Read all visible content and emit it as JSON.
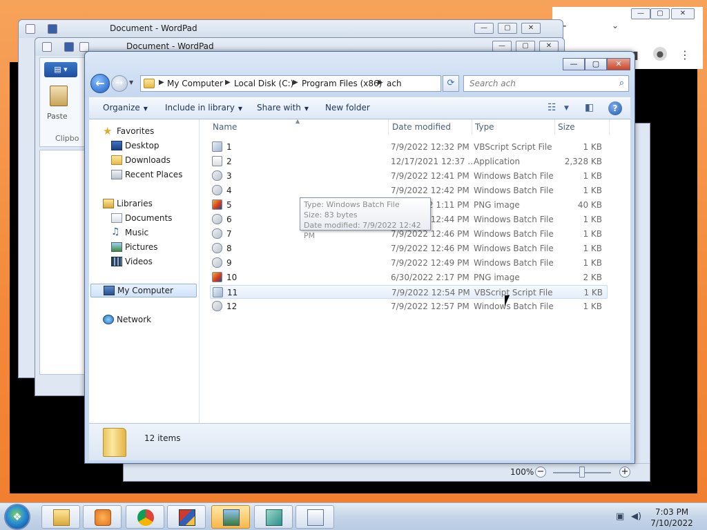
{
  "wordpad_back": {
    "title": "Document - WordPad"
  },
  "wordpad_front": {
    "title": "Document - WordPad",
    "paste_label": "Paste",
    "clipboard_label": "Clipbo",
    "zoom": "100%"
  },
  "explorer": {
    "breadcrumb": [
      "My Computer",
      "Local Disk (C:)",
      "Program Files (x86)",
      "ach"
    ],
    "search_placeholder": "Search ach",
    "toolbar": {
      "organize": "Organize",
      "include_in_library": "Include in library",
      "share_with": "Share with",
      "new_folder": "New folder"
    },
    "nav": {
      "favorites": "Favorites",
      "desktop": "Desktop",
      "downloads": "Downloads",
      "recent_places": "Recent Places",
      "libraries": "Libraries",
      "documents": "Documents",
      "music": "Music",
      "pictures": "Pictures",
      "videos": "Videos",
      "my_computer": "My Computer",
      "network": "Network"
    },
    "columns": {
      "name": "Name",
      "date": "Date modified",
      "type": "Type",
      "size": "Size"
    },
    "files": [
      {
        "name": "1",
        "date": "7/9/2022 12:32 PM",
        "type": "VBScript Script File",
        "size": "1 KB",
        "icon": "vbs"
      },
      {
        "name": "2",
        "date": "12/17/2021 12:37 ...",
        "type": "Application",
        "size": "2,328 KB",
        "icon": "exe"
      },
      {
        "name": "3",
        "date": "7/9/2022 12:41 PM",
        "type": "Windows Batch File",
        "size": "1 KB",
        "icon": "bat"
      },
      {
        "name": "4",
        "date": "7/9/2022 12:42 PM",
        "type": "Windows Batch File",
        "size": "1 KB",
        "icon": "bat"
      },
      {
        "name": "5",
        "date": "6/16/2022 1:11 PM",
        "type": "PNG image",
        "size": "40 KB",
        "icon": "png"
      },
      {
        "name": "6",
        "date": "7/9/2022 12:44 PM",
        "type": "Windows Batch File",
        "size": "1 KB",
        "icon": "bat"
      },
      {
        "name": "7",
        "date": "7/9/2022 12:46 PM",
        "type": "Windows Batch File",
        "size": "1 KB",
        "icon": "bat"
      },
      {
        "name": "8",
        "date": "7/9/2022 12:46 PM",
        "type": "Windows Batch File",
        "size": "1 KB",
        "icon": "bat"
      },
      {
        "name": "9",
        "date": "7/9/2022 12:49 PM",
        "type": "Windows Batch File",
        "size": "1 KB",
        "icon": "bat"
      },
      {
        "name": "10",
        "date": "6/30/2022 2:17 PM",
        "type": "PNG image",
        "size": "2 KB",
        "icon": "png"
      },
      {
        "name": "11",
        "date": "7/9/2022 12:54 PM",
        "type": "VBScript Script File",
        "size": "1 KB",
        "icon": "vbs"
      },
      {
        "name": "12",
        "date": "7/9/2022 12:57 PM",
        "type": "Windows Batch File",
        "size": "1 KB",
        "icon": "bat"
      }
    ],
    "tooltip": {
      "type": "Type: Windows Batch File",
      "size": "Size: 83 bytes",
      "date": "Date modified: 7/9/2022 12:42 PM"
    },
    "status": {
      "items": "12 items"
    }
  },
  "taskbar": {
    "time": "7:03 PM",
    "date": "7/10/2022"
  }
}
